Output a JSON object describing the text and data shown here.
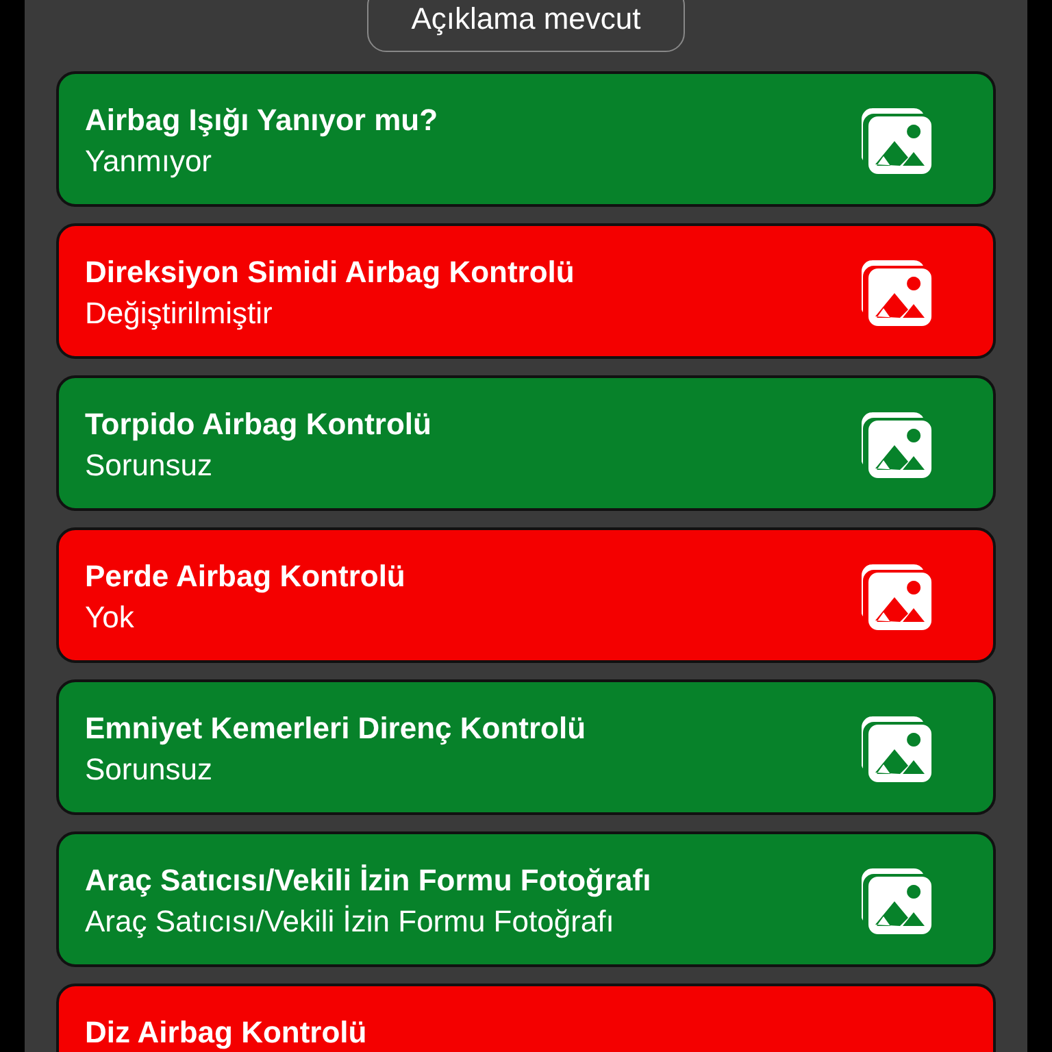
{
  "description_button": {
    "label": "Açıklama mevcut"
  },
  "checks": [
    {
      "title": "Airbag Işığı Yanıyor mu?",
      "value": "Yanmıyor",
      "color": "#07822a",
      "photo": true
    },
    {
      "title": "Direksiyon Simidi Airbag Kontrolü",
      "value": "Değiştirilmiştir",
      "color": "#f40000",
      "photo": true
    },
    {
      "title": "Torpido Airbag Kontrolü",
      "value": "Sorunsuz",
      "color": "#07822a",
      "photo": true
    },
    {
      "title": "Perde Airbag Kontrolü",
      "value": "Yok",
      "color": "#f40000",
      "photo": true
    },
    {
      "title": "Emniyet Kemerleri Direnç Kontrolü",
      "value": "Sorunsuz",
      "color": "#07822a",
      "photo": true
    },
    {
      "title": "Araç Satıcısı/Vekili İzin Formu Fotoğrafı",
      "value": "Araç Satıcısı/Vekili İzin Formu Fotoğrafı",
      "color": "#07822a",
      "photo": true
    },
    {
      "title": "Diz Airbag Kontrolü",
      "color": "#f40000",
      "photo": false
    }
  ]
}
